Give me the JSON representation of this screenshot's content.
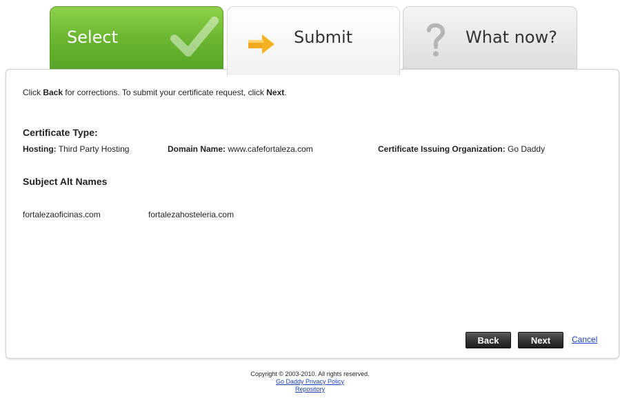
{
  "tabs": [
    {
      "label": "Select"
    },
    {
      "label": "Submit"
    },
    {
      "label": "What now?"
    }
  ],
  "instructions": {
    "prefix": "Click ",
    "back": "Back",
    "middle": " for corrections. To submit your certificate request, click ",
    "next": "Next",
    "suffix": "."
  },
  "certificate": {
    "heading": "Certificate Type:",
    "hosting_label": "Hosting:",
    "hosting_value": "Third Party Hosting",
    "domain_label": "Domain Name:",
    "domain_value": "www.cafefortaleza.com",
    "org_label": "Certificate Issuing Organization:",
    "org_value": "Go Daddy"
  },
  "alt_names": {
    "heading": "Subject Alt Names",
    "items": [
      "fortalezaoficinas.com",
      "fortalezahosteleria.com"
    ]
  },
  "actions": {
    "back": "Back",
    "next": "Next",
    "cancel": "Cancel"
  },
  "footer": {
    "copyright": "Copyright © 2003-2010. All rights reserved.",
    "privacy": "Go Daddy Privacy Policy",
    "repository": "Repository"
  },
  "colors": {
    "select_tab": "#6cb832",
    "button": "#333333",
    "link": "#1a3fbf"
  },
  "icons": {
    "select": "checkmark-icon",
    "submit": "arrow-right-icon",
    "whatnow": "question-mark-icon"
  }
}
